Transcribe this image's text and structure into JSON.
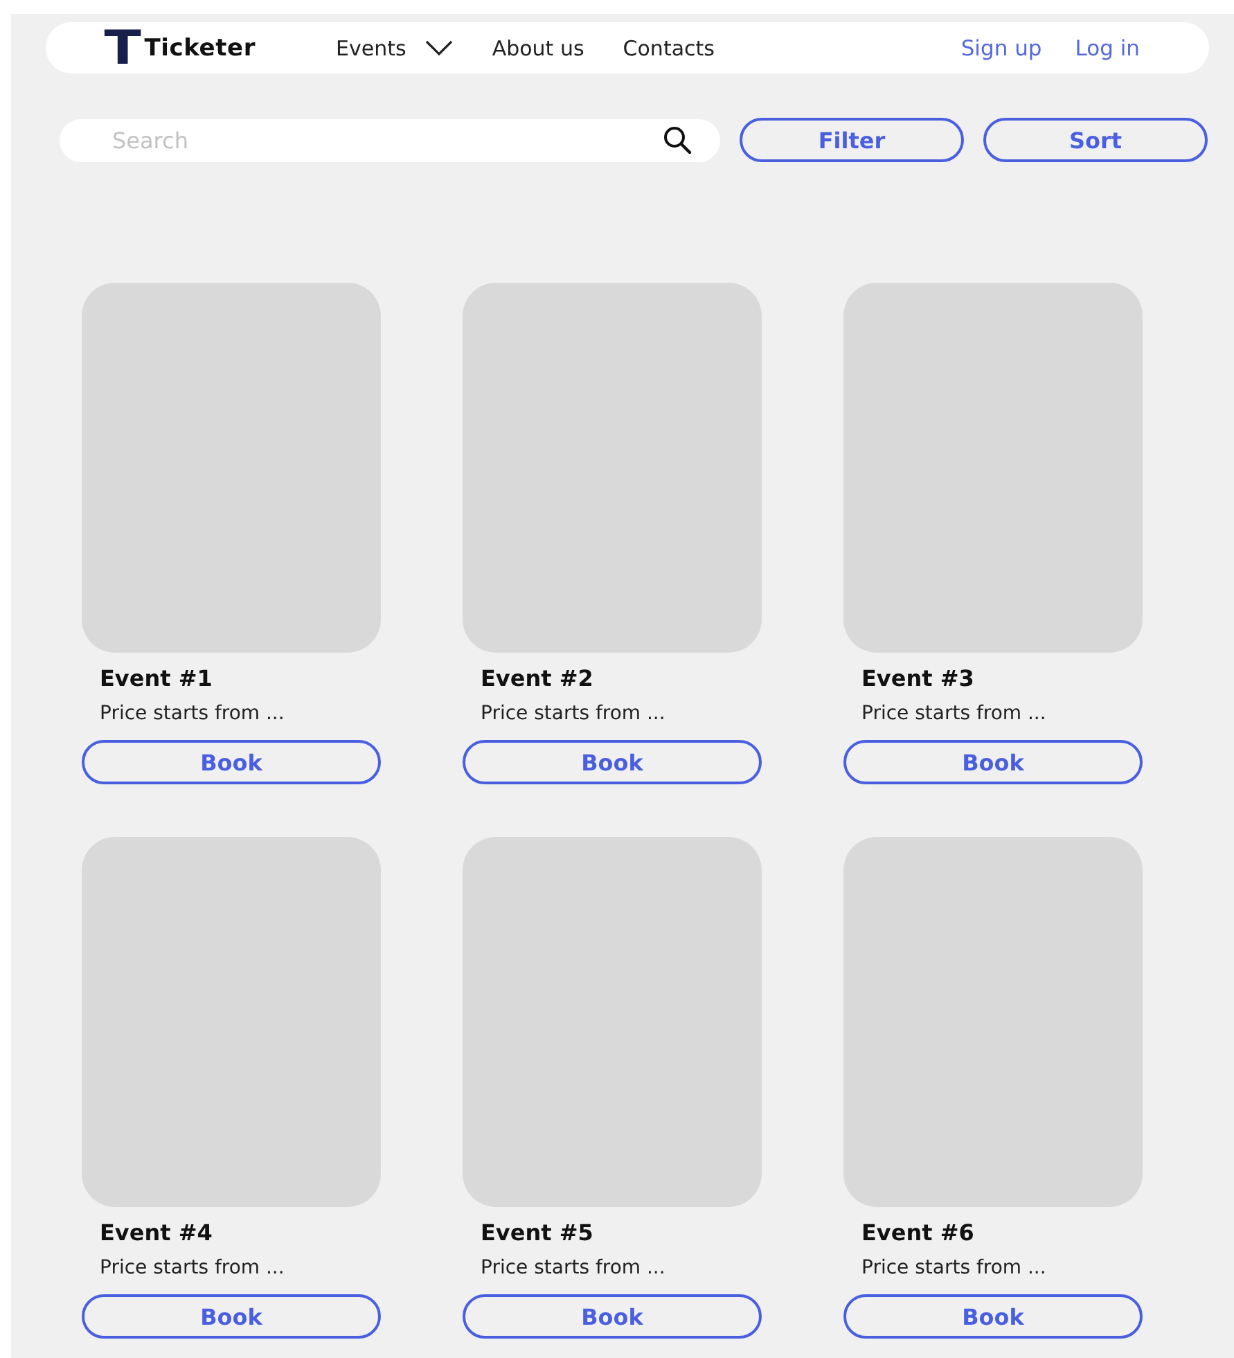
{
  "nav": {
    "logo_mark": "T",
    "logo_text": "Ticketer",
    "links": [
      {
        "label": "Events",
        "kind": "dropdown"
      },
      {
        "label": "About us",
        "kind": "link"
      },
      {
        "label": "Contacts",
        "kind": "link"
      }
    ],
    "auth": [
      "Sign up",
      "Log in"
    ]
  },
  "search": {
    "placeholder": "Search"
  },
  "actions": [
    "Filter",
    "Sort"
  ],
  "events": [
    {
      "title": "Event #1",
      "price": "Price starts from ...",
      "button": "Book"
    },
    {
      "title": "Event #2",
      "price": "Price starts from ...",
      "button": "Book"
    },
    {
      "title": "Event #3",
      "price": "Price starts from ...",
      "button": "Book"
    },
    {
      "title": "Event #4",
      "price": "Price starts from ...",
      "button": "Book"
    },
    {
      "title": "Event #5",
      "price": "Price starts from ...",
      "button": "Book"
    },
    {
      "title": "Event #6",
      "price": "Price starts from ...",
      "button": "Book"
    }
  ]
}
